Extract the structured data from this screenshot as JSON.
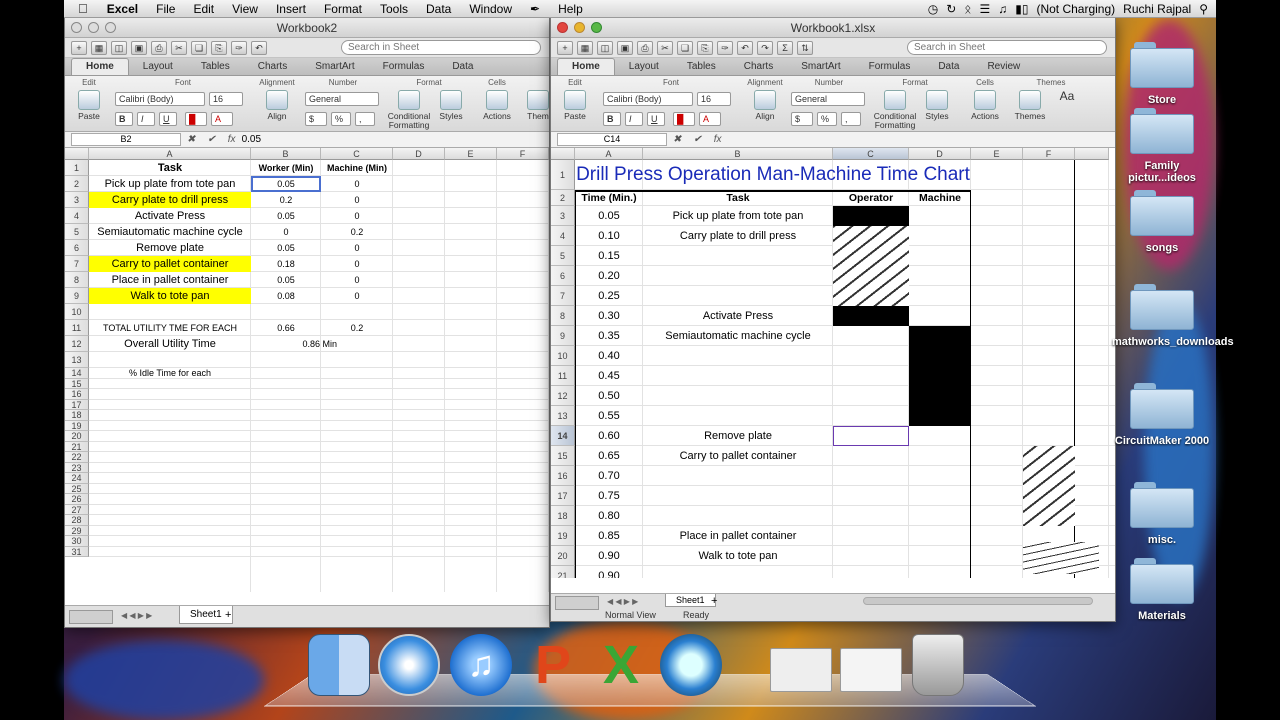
{
  "menubar": {
    "apple": "",
    "app": "Excel",
    "items": [
      "File",
      "Edit",
      "View",
      "Insert",
      "Format",
      "Tools",
      "Data",
      "Window",
      "Help"
    ],
    "battery": "(Not Charging)",
    "user": "Ruchi Rajpal"
  },
  "win1": {
    "title": "Workbook2",
    "search_placeholder": "Search in Sheet",
    "tabs": [
      "Home",
      "Layout",
      "Tables",
      "Charts",
      "SmartArt",
      "Formulas",
      "Data"
    ],
    "groups": [
      "Edit",
      "Font",
      "Alignment",
      "Number",
      "Format",
      "Cells"
    ],
    "font_name": "Calibri (Body)",
    "font_size": "16",
    "number_format": "General",
    "labels": {
      "paste": "Paste",
      "align": "Align",
      "conditional": "Conditional Formatting",
      "styles": "Styles",
      "actions": "Actions",
      "themes": "Them"
    },
    "namebox": "B2",
    "formula": "0.05",
    "col_headers": [
      "A",
      "B",
      "C",
      "D",
      "E",
      "F"
    ],
    "header_row": {
      "task": "Task",
      "worker": "Worker (Min)",
      "machine": "Machine (Min)"
    },
    "rows": [
      {
        "task": "Pick up plate from tote pan",
        "worker": "0.05",
        "machine": "0",
        "hl": false
      },
      {
        "task": "Carry plate to drill press",
        "worker": "0.2",
        "machine": "0",
        "hl": true
      },
      {
        "task": "Activate Press",
        "worker": "0.05",
        "machine": "0",
        "hl": false
      },
      {
        "task": "Semiautomatic machine cycle",
        "worker": "0",
        "machine": "0.2",
        "hl": false
      },
      {
        "task": "Remove plate",
        "worker": "0.05",
        "machine": "0",
        "hl": false
      },
      {
        "task": "Carry to pallet container",
        "worker": "0.18",
        "machine": "0",
        "hl": true
      },
      {
        "task": "Place in pallet container",
        "worker": "0.05",
        "machine": "0",
        "hl": false
      },
      {
        "task": "Walk to tote pan",
        "worker": "0.08",
        "machine": "0",
        "hl": true
      }
    ],
    "total_label": "TOTAL UTILITY TME FOR EACH",
    "total_worker": "0.66",
    "total_machine": "0.2",
    "overall_label": "Overall Utility Time",
    "overall_value": "0.86 Min",
    "idle_label": "% Idle Time for each",
    "sheet_tab": "Sheet1"
  },
  "win2": {
    "title": "Workbook1.xlsx",
    "search_placeholder": "Search in Sheet",
    "tabs": [
      "Home",
      "Layout",
      "Tables",
      "Charts",
      "SmartArt",
      "Formulas",
      "Data",
      "Review"
    ],
    "groups": [
      "Edit",
      "Font",
      "Alignment",
      "Number",
      "Format",
      "Cells",
      "Themes"
    ],
    "font_name": "Calibri (Body)",
    "font_size": "16",
    "number_format": "General",
    "labels": {
      "paste": "Paste",
      "align": "Align",
      "conditional": "Conditional Formatting",
      "styles": "Styles",
      "actions": "Actions",
      "themes": "Themes"
    },
    "namebox": "C14",
    "formula": "",
    "col_headers": [
      "A",
      "B",
      "C",
      "D",
      "E",
      "F"
    ],
    "chart_title": "Drill Press Operation Man-Machine Time Chart",
    "hdr": {
      "time": "Time (Min.)",
      "task": "Task",
      "operator": "Operator",
      "machine": "Machine"
    },
    "times": [
      "0.05",
      "0.10",
      "0.15",
      "0.20",
      "0.25",
      "0.30",
      "0.35",
      "0.40",
      "0.45",
      "0.50",
      "0.55",
      "0.60",
      "0.65",
      "0.70",
      "0.75",
      "0.80",
      "0.85",
      "0.90",
      "0.90"
    ],
    "tasks": [
      {
        "row": 3,
        "text": "Pick up plate from tote pan"
      },
      {
        "row": 4,
        "text": "Carry plate to drill press"
      },
      {
        "row": 8,
        "text": "Activate Press"
      },
      {
        "row": 9,
        "text": "Semiautomatic machine cycle"
      },
      {
        "row": 14,
        "text": "Remove plate"
      },
      {
        "row": 15,
        "text": "Carry to pallet container"
      },
      {
        "row": 19,
        "text": "Place in pallet container"
      },
      {
        "row": 20,
        "text": "Walk to tote pan"
      }
    ],
    "sheet_tab": "Sheet1",
    "status_view": "Normal View",
    "status_ready": "Ready"
  },
  "desktop": [
    "Store",
    "Family pictur...ideos",
    "songs",
    "mathworks_downloads",
    "CircuitMaker 2000",
    "misc.",
    "Materials"
  ]
}
